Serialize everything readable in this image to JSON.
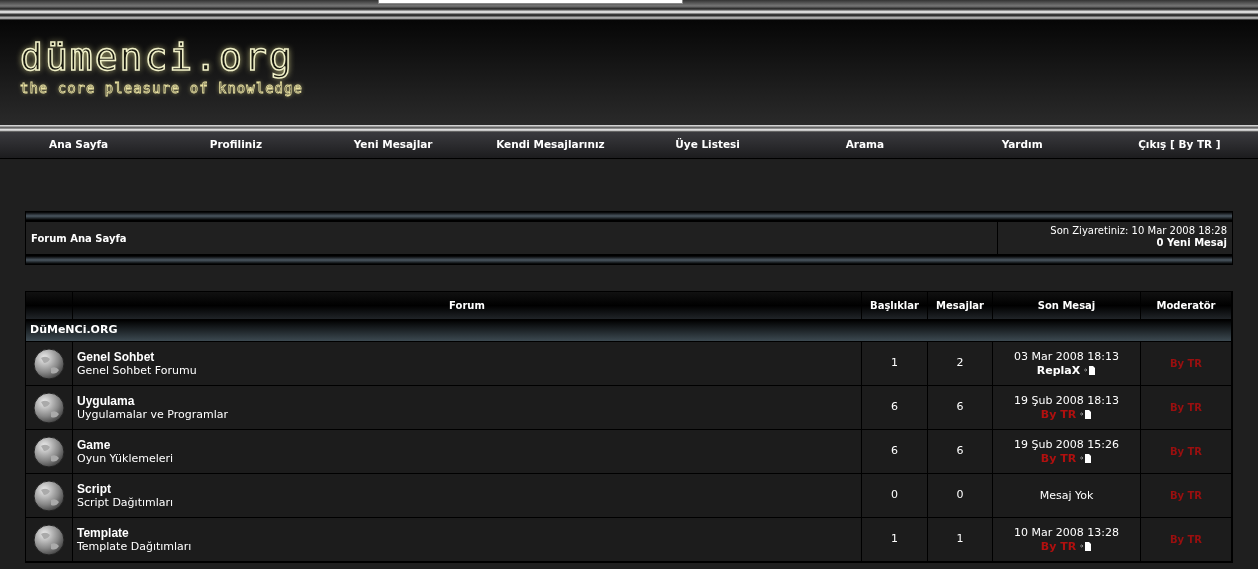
{
  "logo": {
    "title": "dümenci.org",
    "tagline": "the core pleasure of knowledge"
  },
  "nav": [
    "Ana Sayfa",
    "Profiliniz",
    "Yeni Mesajlar",
    "Kendi Mesajlarınız",
    "Üye Listesi",
    "Arama",
    "Yardım",
    "Çıkış [ By TR ]"
  ],
  "breadcrumb": {
    "link": "Forum Ana Sayfa",
    "last_visit": "Son Ziyaretiniz: 10 Mar 2008 18:28",
    "new_posts": "0 Yeni Mesaj"
  },
  "table": {
    "columns": [
      "Forum",
      "Başlıklar",
      "Mesajlar",
      "Son Mesaj",
      "Moderatör"
    ],
    "category": "DüMeNCi.ORG",
    "rows": [
      {
        "title": "Genel Sohbet",
        "description": "Genel Sohbet Forumu",
        "topics": "1",
        "posts": "2",
        "last_post": {
          "date": "03 Mar 2008 18:13",
          "author": "ReplaX",
          "color": "#ffffff"
        },
        "moderator": "By TR"
      },
      {
        "title": "Uygulama",
        "description": "Uygulamalar ve Programlar",
        "topics": "6",
        "posts": "6",
        "last_post": {
          "date": "19 Şub 2008 18:13",
          "author": "By TR",
          "color": "#b0100f"
        },
        "moderator": "By TR"
      },
      {
        "title": "Game",
        "description": "Oyun Yüklemeleri",
        "topics": "6",
        "posts": "6",
        "last_post": {
          "date": "19 Şub 2008 15:26",
          "author": "By TR",
          "color": "#b0100f"
        },
        "moderator": "By TR"
      },
      {
        "title": "Script",
        "description": "Script Dağıtımları",
        "topics": "0",
        "posts": "0",
        "last_post": {
          "text": "Mesaj Yok"
        },
        "moderator": "By TR"
      },
      {
        "title": "Template",
        "description": "Template Dağıtımları",
        "topics": "1",
        "posts": "1",
        "last_post": {
          "date": "10 Mar 2008 13:28",
          "author": "By TR",
          "color": "#b0100f"
        },
        "moderator": "By TR"
      }
    ]
  }
}
